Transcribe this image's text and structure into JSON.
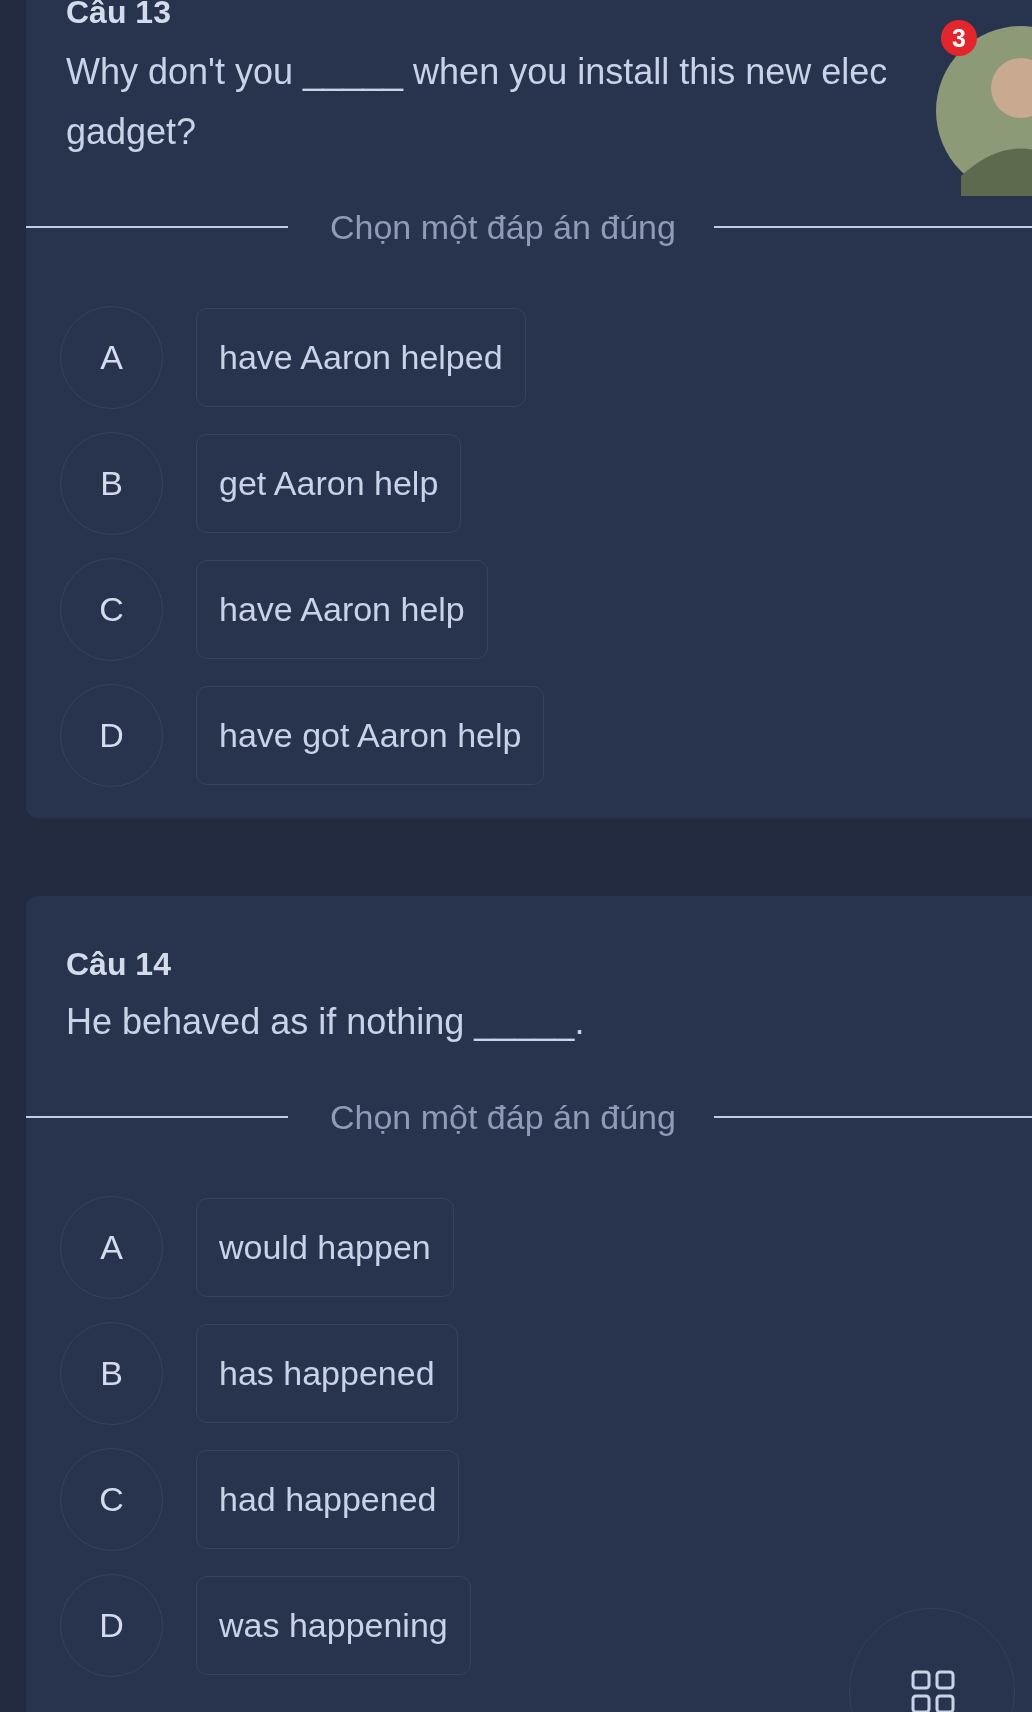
{
  "questions": [
    {
      "title": "Câu 13",
      "question_lines": [
        "Why don't you _____ when you install this new elec",
        "gadget?"
      ],
      "instruction": "Chọn một đáp án đúng",
      "options": [
        {
          "letter": "A",
          "text": "have Aaron helped"
        },
        {
          "letter": "B",
          "text": "get Aaron help"
        },
        {
          "letter": "C",
          "text": "have Aaron help"
        },
        {
          "letter": "D",
          "text": "have got Aaron help"
        }
      ]
    },
    {
      "title": "Câu 14",
      "question_lines": [
        "He behaved as if nothing _____."
      ],
      "instruction": "Chọn một đáp án đúng",
      "options": [
        {
          "letter": "A",
          "text": "would happen"
        },
        {
          "letter": "B",
          "text": "has happened"
        },
        {
          "letter": "C",
          "text": "had happened"
        },
        {
          "letter": "D",
          "text": "was happening"
        }
      ]
    }
  ],
  "chat_head": {
    "badge": "3"
  }
}
